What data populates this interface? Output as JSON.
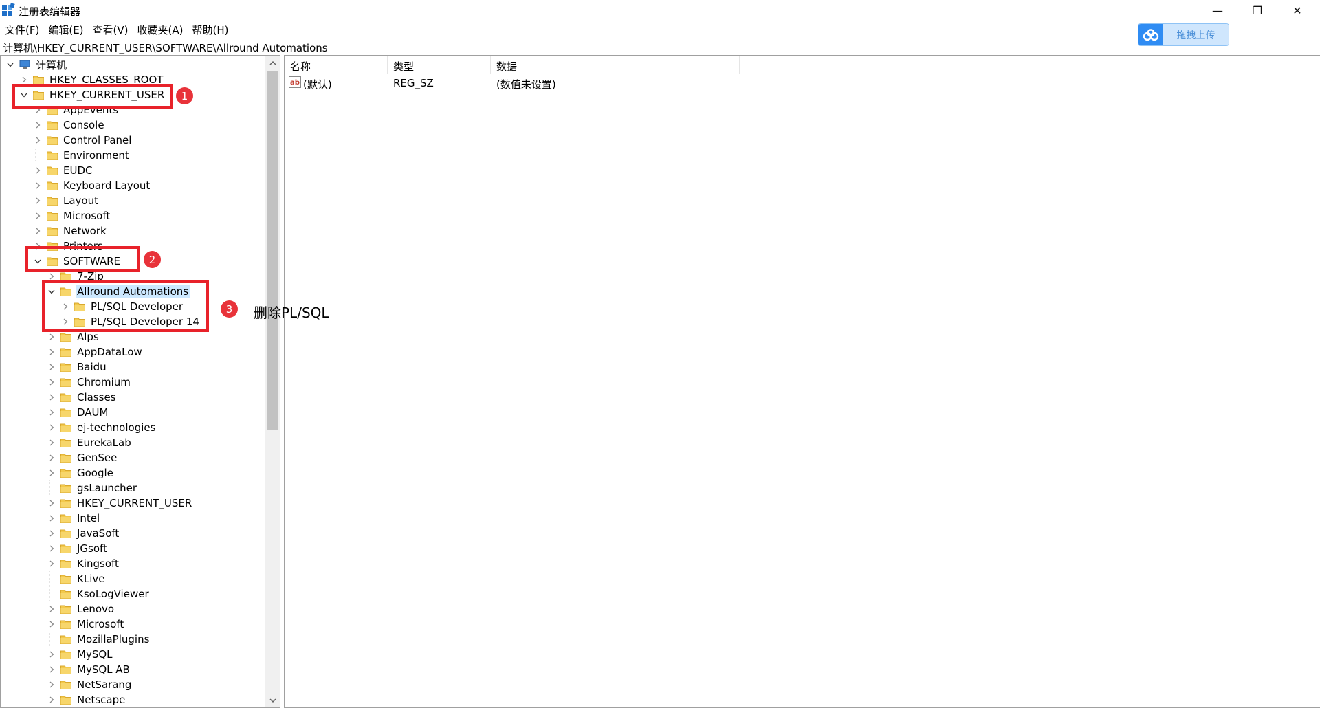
{
  "window": {
    "title": "注册表编辑器",
    "controls": {
      "minimize": "—",
      "maximize": "❐",
      "close": "✕"
    }
  },
  "menu": [
    "文件(F)",
    "编辑(E)",
    "查看(V)",
    "收藏夹(A)",
    "帮助(H)"
  ],
  "upload_badge": {
    "label": "拖拽上传"
  },
  "address": "计算机\\HKEY_CURRENT_USER\\SOFTWARE\\Allround Automations",
  "tree": {
    "rows": [
      {
        "label": "计算机",
        "level": 0,
        "state": "expanded",
        "icon": "computer-icon"
      },
      {
        "label": "HKEY_CLASSES_ROOT",
        "level": 1,
        "state": "collapsed"
      },
      {
        "label": "HKEY_CURRENT_USER",
        "level": 1,
        "state": "expanded"
      },
      {
        "label": "AppEvents",
        "level": 2,
        "state": "collapsed"
      },
      {
        "label": "Console",
        "level": 2,
        "state": "collapsed"
      },
      {
        "label": "Control Panel",
        "level": 2,
        "state": "collapsed"
      },
      {
        "label": "Environment",
        "level": 2,
        "state": "leaf"
      },
      {
        "label": "EUDC",
        "level": 2,
        "state": "collapsed"
      },
      {
        "label": "Keyboard Layout",
        "level": 2,
        "state": "collapsed"
      },
      {
        "label": "Layout",
        "level": 2,
        "state": "collapsed"
      },
      {
        "label": "Microsoft",
        "level": 2,
        "state": "collapsed"
      },
      {
        "label": "Network",
        "level": 2,
        "state": "collapsed"
      },
      {
        "label": "Printers",
        "level": 2,
        "state": "collapsed"
      },
      {
        "label": "SOFTWARE",
        "level": 2,
        "state": "expanded"
      },
      {
        "label": "7-Zip",
        "level": 3,
        "state": "collapsed"
      },
      {
        "label": "Allround Automations",
        "level": 3,
        "state": "expanded",
        "selected": true
      },
      {
        "label": "PL/SQL Developer",
        "level": 4,
        "state": "collapsed"
      },
      {
        "label": "PL/SQL Developer 14",
        "level": 4,
        "state": "collapsed"
      },
      {
        "label": "Alps",
        "level": 3,
        "state": "collapsed"
      },
      {
        "label": "AppDataLow",
        "level": 3,
        "state": "collapsed"
      },
      {
        "label": "Baidu",
        "level": 3,
        "state": "collapsed"
      },
      {
        "label": "Chromium",
        "level": 3,
        "state": "collapsed"
      },
      {
        "label": "Classes",
        "level": 3,
        "state": "collapsed"
      },
      {
        "label": "DAUM",
        "level": 3,
        "state": "collapsed"
      },
      {
        "label": "ej-technologies",
        "level": 3,
        "state": "collapsed"
      },
      {
        "label": "EurekaLab",
        "level": 3,
        "state": "collapsed"
      },
      {
        "label": "GenSee",
        "level": 3,
        "state": "collapsed"
      },
      {
        "label": "Google",
        "level": 3,
        "state": "collapsed"
      },
      {
        "label": "gsLauncher",
        "level": 3,
        "state": "leaf"
      },
      {
        "label": "HKEY_CURRENT_USER",
        "level": 3,
        "state": "collapsed"
      },
      {
        "label": "Intel",
        "level": 3,
        "state": "collapsed"
      },
      {
        "label": "JavaSoft",
        "level": 3,
        "state": "collapsed"
      },
      {
        "label": "JGsoft",
        "level": 3,
        "state": "collapsed"
      },
      {
        "label": "Kingsoft",
        "level": 3,
        "state": "collapsed"
      },
      {
        "label": "KLive",
        "level": 3,
        "state": "leaf"
      },
      {
        "label": "KsoLogViewer",
        "level": 3,
        "state": "leaf"
      },
      {
        "label": "Lenovo",
        "level": 3,
        "state": "collapsed"
      },
      {
        "label": "Microsoft",
        "level": 3,
        "state": "collapsed"
      },
      {
        "label": "MozillaPlugins",
        "level": 3,
        "state": "leaf"
      },
      {
        "label": "MySQL",
        "level": 3,
        "state": "collapsed"
      },
      {
        "label": "MySQL AB",
        "level": 3,
        "state": "collapsed"
      },
      {
        "label": "NetSarang",
        "level": 3,
        "state": "collapsed"
      },
      {
        "label": "Netscape",
        "level": 3,
        "state": "collapsed"
      }
    ]
  },
  "list": {
    "columns": [
      "名称",
      "类型",
      "数据"
    ],
    "rows": [
      {
        "name": "(默认)",
        "type": "REG_SZ",
        "data": "(数值未设置)",
        "icon": "string-value-icon"
      }
    ]
  },
  "annotations": {
    "markers": [
      "1",
      "2",
      "3"
    ],
    "note": "删除PL/SQL",
    "color": "#e8222a"
  }
}
